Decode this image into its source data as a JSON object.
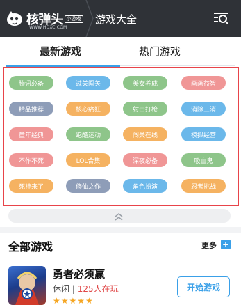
{
  "header": {
    "logo_text": "核弹头",
    "logo_badge": "小游戏",
    "logo_url": "WWW.HDXC.COM",
    "title": "游戏大全"
  },
  "tabs": [
    {
      "label": "最新游戏",
      "active": true
    },
    {
      "label": "热门游戏",
      "active": false
    }
  ],
  "tags": [
    {
      "label": "腾讯必备",
      "color": "#8ec58a"
    },
    {
      "label": "过关闯关",
      "color": "#6bb8ea"
    },
    {
      "label": "美女养成",
      "color": "#8ec58a"
    },
    {
      "label": "画画益智",
      "color": "#f09696"
    },
    {
      "label": "精品推荐",
      "color": "#8e9db8"
    },
    {
      "label": "核心痛狂",
      "color": "#f5b261"
    },
    {
      "label": "射击打枪",
      "color": "#8ec58a"
    },
    {
      "label": "消除三消",
      "color": "#6bb8ea"
    },
    {
      "label": "童年经典",
      "color": "#f09696"
    },
    {
      "label": "跑酷运动",
      "color": "#8ec58a"
    },
    {
      "label": "闯关在线",
      "color": "#f5b261"
    },
    {
      "label": "模拟经营",
      "color": "#6bb8ea"
    },
    {
      "label": "不作不死",
      "color": "#f09696"
    },
    {
      "label": "LOL合集",
      "color": "#f5b261"
    },
    {
      "label": "深夜必备",
      "color": "#f09696"
    },
    {
      "label": "吸血鬼",
      "color": "#8ec58a"
    },
    {
      "label": "死神来了",
      "color": "#f5b261"
    },
    {
      "label": "修仙之作",
      "color": "#8e9db8"
    },
    {
      "label": "角色扮演",
      "color": "#6bb8ea"
    },
    {
      "label": "忍者挑战",
      "color": "#f5b261"
    }
  ],
  "all_games": {
    "title": "全部游戏",
    "more_label": "更多",
    "more_icon": "+",
    "games": [
      {
        "name": "勇者必须赢",
        "category": "休闲",
        "separator": "|",
        "players": "125人在玩",
        "stars": "★★★★★",
        "button": "开始游戏"
      }
    ]
  }
}
